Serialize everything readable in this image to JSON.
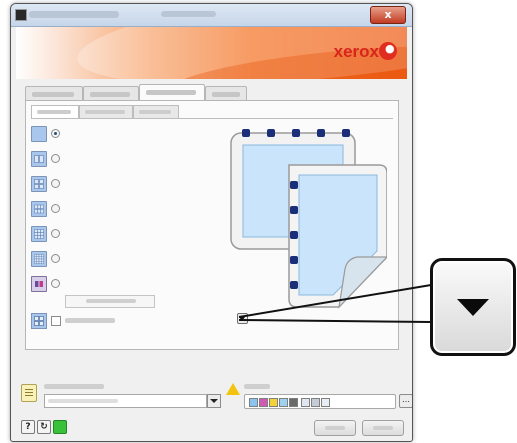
{
  "window": {
    "close_glyph": "x",
    "colors": {
      "banner": "#f47528",
      "brand_red": "#d8261c",
      "title_bar": "#c6d6ea"
    }
  },
  "banner": {
    "brand_text": "xerox"
  },
  "layout_options": [
    {
      "icon": "single-page-layout-icon",
      "selected": true
    },
    {
      "icon": "two-up-layout-icon",
      "selected": false
    },
    {
      "icon": "four-up-layout-icon",
      "selected": false
    },
    {
      "icon": "six-up-layout-icon",
      "selected": false
    },
    {
      "icon": "nine-up-layout-icon",
      "selected": false
    },
    {
      "icon": "sixteen-up-layout-icon",
      "selected": false
    },
    {
      "icon": "booklet-layout-icon",
      "selected": false
    }
  ],
  "preview": {
    "icon": "page-layout-preview-icon"
  },
  "callout": {
    "icon": "dropdown-arrow-icon"
  },
  "bottom_bar": {
    "help_glyph": "?",
    "reset_glyph": "↻",
    "more_glyph": "…"
  }
}
